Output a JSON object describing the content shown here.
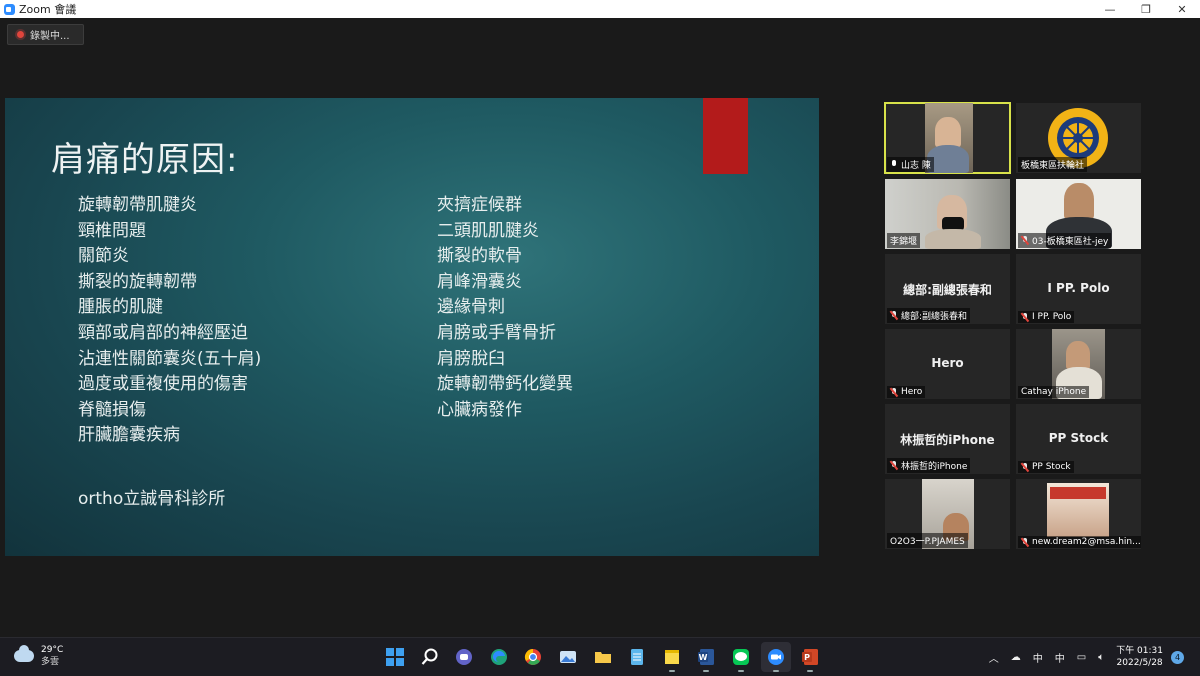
{
  "window": {
    "title": "Zoom 會議",
    "minimize": "—",
    "maximize": "❐",
    "close": "✕"
  },
  "recording": {
    "label": "錄製中..."
  },
  "slide": {
    "title": "肩痛的原因:",
    "left_items": [
      "旋轉韌帶肌腱炎",
      "頸椎問題",
      "關節炎",
      "撕裂的旋轉韌帶",
      "腫脹的肌腱",
      "頸部或肩部的神經壓迫",
      "沾連性關節囊炎(五十肩)",
      "過度或重複使用的傷害",
      "脊髓損傷",
      "肝臟膽囊疾病"
    ],
    "right_items": [
      "夾擠症候群",
      "二頭肌肌腱炎",
      "撕裂的軟骨",
      "肩峰滑囊炎",
      "邊緣骨刺",
      "肩膀或手臂骨折",
      "肩膀脫臼",
      "旋轉韌帶鈣化變異",
      "心臟病發作"
    ],
    "footer": "ortho立誠骨科診所",
    "accent_color": "#b31b1b"
  },
  "participants": [
    {
      "label": "山志 陳",
      "big_name": "",
      "mic": "on",
      "active": true
    },
    {
      "label": "板橋東區扶輪社",
      "big_name": "",
      "mic": "none",
      "active": false
    },
    {
      "label": "李錦堰",
      "big_name": "",
      "mic": "none",
      "active": false
    },
    {
      "label": "03-板橋東區社-jey",
      "big_name": "",
      "mic": "off",
      "active": false
    },
    {
      "label": "總部:副總張春和",
      "big_name": "總部:副總張春和",
      "mic": "off",
      "active": false
    },
    {
      "label": "I PP. Polo",
      "big_name": "I PP.  Polo",
      "mic": "off",
      "active": false
    },
    {
      "label": "Hero",
      "big_name": "Hero",
      "mic": "off",
      "active": false
    },
    {
      "label": "Cathay iPhone",
      "big_name": "",
      "mic": "none",
      "active": false
    },
    {
      "label": "林振哲的iPhone",
      "big_name": "林振哲的iPhone",
      "mic": "off",
      "active": false
    },
    {
      "label": "PP Stock",
      "big_name": "PP Stock",
      "mic": "off",
      "active": false
    },
    {
      "label": "O2O3一P.PJAMES",
      "big_name": "",
      "mic": "none",
      "active": false
    },
    {
      "label": "new.dream2@msa.hin...",
      "big_name": "",
      "mic": "off",
      "active": false
    }
  ],
  "taskbar": {
    "weather_temp": "29°C",
    "weather_desc": "多雲",
    "apps": [
      "start",
      "search",
      "teams-chat",
      "edge",
      "chrome",
      "photos",
      "file-explorer",
      "notepad",
      "sticky-notes",
      "word",
      "line",
      "zoom",
      "powerpoint"
    ],
    "tray_lang": "中",
    "tray_ime": "中",
    "time": "下午 01:31",
    "date": "2022/5/28",
    "notification_count": "4"
  }
}
